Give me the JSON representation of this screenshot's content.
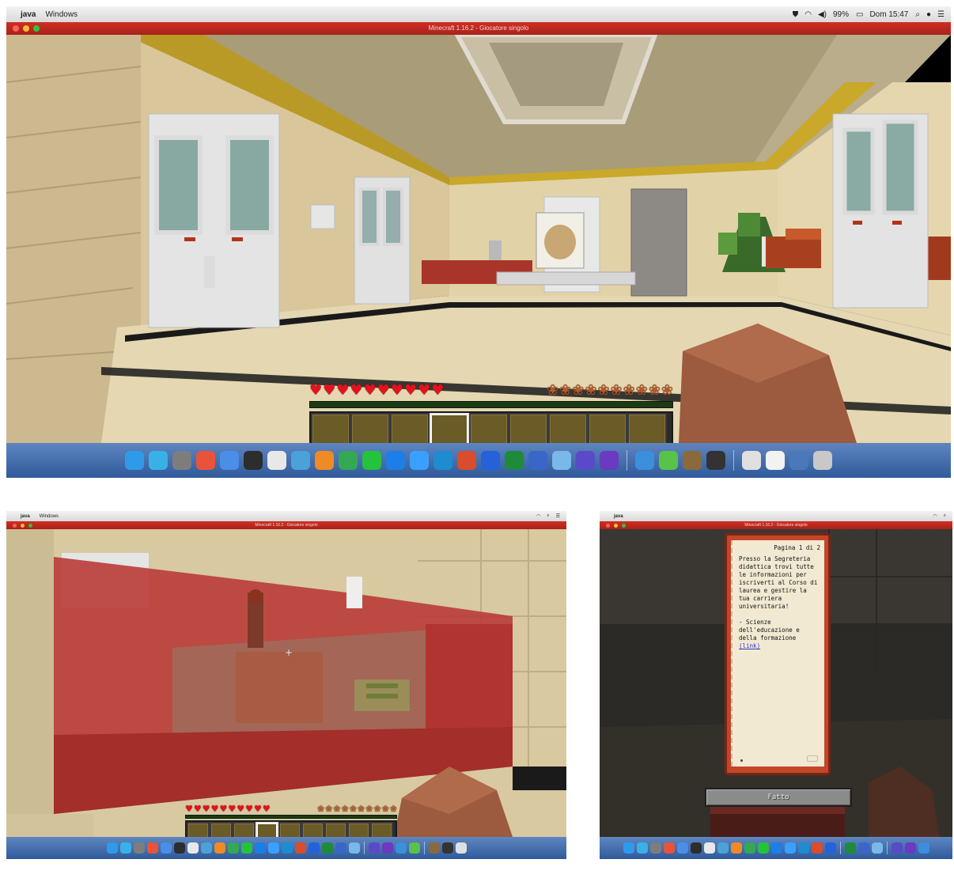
{
  "menubar": {
    "app_name": "java",
    "menu_window": "Windows",
    "battery": "99%",
    "clock": "Dom 15:47",
    "small_app_name": "java",
    "small_menu_window": "Windows"
  },
  "windows": {
    "title_main": "Minecraft 1.16.2 - Giocatore singolo",
    "title_red": "Minecraft 1.16.2 - Giocatore singolo",
    "title_book": "Minecraft 1.16.2 - Giocatore singolo"
  },
  "hud": {
    "hearts": 10,
    "food": 10,
    "slots": 9,
    "selected_slot": 4
  },
  "hud_red": {
    "hearts": 10,
    "food": 10,
    "slots": 9,
    "selected_slot": 4
  },
  "book": {
    "page_indicator": "Pagina 1 di 2",
    "body_text": "Presso la Segreteria didattica trovi tutte le informazioni per iscriverti al Corso di laurea e gestire la tua carriera universitaria!\n\n- Scienze dell'educazione e della formazione ",
    "link_text": "(link)",
    "done_button": "Fatto"
  },
  "colors": {
    "menubar": "#e4e4e4",
    "titlebar": "#b8271e",
    "dock": "#3f6aaa",
    "heart": "#e0141c",
    "book_cover": "#c2462a",
    "page": "#f1e9d2",
    "link": "#3433c8"
  },
  "icons": {
    "heart": "heart-icon",
    "food": "food-icon",
    "apple": "apple-icon",
    "wifi": "wifi-icon",
    "volume": "volume-icon",
    "battery": "battery-icon",
    "search": "search-icon",
    "trash": "trash-icon"
  }
}
